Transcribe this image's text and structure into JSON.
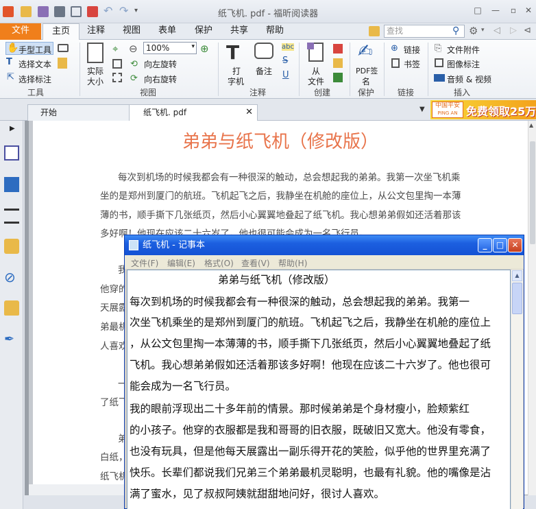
{
  "app": {
    "title": "纸飞机. pdf - 福昕阅读器"
  },
  "ribbon_tabs": [
    "文件",
    "主页",
    "注释",
    "视图",
    "表单",
    "保护",
    "共享",
    "帮助"
  ],
  "search": {
    "placeholder": "查找"
  },
  "tools": {
    "hand": "手型工具",
    "select_text": "选择文本",
    "select_annot": "选择标注",
    "group": "工具",
    "actual_size_1": "实际",
    "actual_size_2": "大小",
    "zoom_value": "100%",
    "rotate_left": "向左旋转",
    "rotate_right": "向右旋转",
    "view_group": "视图",
    "typewriter_1": "打",
    "typewriter_2": "字机",
    "note": "备注",
    "annot_group": "注释",
    "from_file_1": "从",
    "from_file_2": "文件",
    "create_group": "创建",
    "pdf_sign_1": "PDF签",
    "pdf_sign_2": "名",
    "protect_group": "保护",
    "link": "链接",
    "bookmark": "书签",
    "link_group": "链接",
    "attach": "文件附件",
    "image_annot": "图像标注",
    "audio_video": "音频 & 视频",
    "insert_group": "插入",
    "abc": "abc"
  },
  "doc_tabs": [
    "开始",
    "纸飞机. pdf"
  ],
  "ad": {
    "brand_1": "中国平安",
    "brand_2": "PING AN",
    "text": "免费领取25万"
  },
  "pdf": {
    "title": "弟弟与纸飞机（修改版）",
    "lines": [
      "每次到机场的时候我都会有一种很深的触动，总会想起我的弟弟。我第一次坐飞机乘",
      "坐的是郑州到厦门的航班。飞机起飞之后，我静坐在机舱的座位上，从公文包里掏一本薄",
      "薄的书，顺手撕下几张纸页，然后小心翼翼地叠起了纸飞机。我心想弟弟假如还活着那该",
      "多好啊！他现在应该二十六岁了。他也很可能会成为一名飞行员。"
    ],
    "partial": [
      "我",
      "他穿的",
      "天展露",
      "弟最机",
      "人喜欢",
      "一",
      "了纸飞",
      "弟",
      "白纸，",
      "纸飞机"
    ]
  },
  "notepad": {
    "title": "纸飞机 - 记事本",
    "menu": [
      "文件(F)",
      "编辑(E)",
      "格式(O)",
      "查看(V)",
      "帮助(H)"
    ],
    "lines": [
      "弟弟与纸飞机（修改版）",
      "    每次到机场的时候我都会有一种很深的触动，总会想起我的弟弟。我第一",
      "次坐飞机乘坐的是郑州到厦门的航班。飞机起飞之后，我静坐在机舱的座位上",
      "，从公文包里掏一本薄薄的书，顺手撕下几张纸页，然后小心翼翼地叠起了纸",
      "飞机。我心想弟弟假如还活着那该多好啊！他现在应该二十六岁了。他也很可",
      "能会成为一名飞行员。",
      "    我的眼前浮现出二十多年前的情景。那时候弟弟是个身材瘦小，脸颊紫红",
      "的小孩子。他穿的衣服都是我和哥哥的旧衣服，既破旧又宽大。他没有零食，",
      "也没有玩具，但是他每天展露出一副乐得开花的笑脸，似乎他的世界里充满了",
      "快乐。长辈们都说我们兄弟三个弟弟最机灵聪明，也最有礼貌。他的嘴像是沾",
      "满了蜜水，见了叔叔阿姨就甜甜地问好，很讨人喜欢。"
    ]
  }
}
